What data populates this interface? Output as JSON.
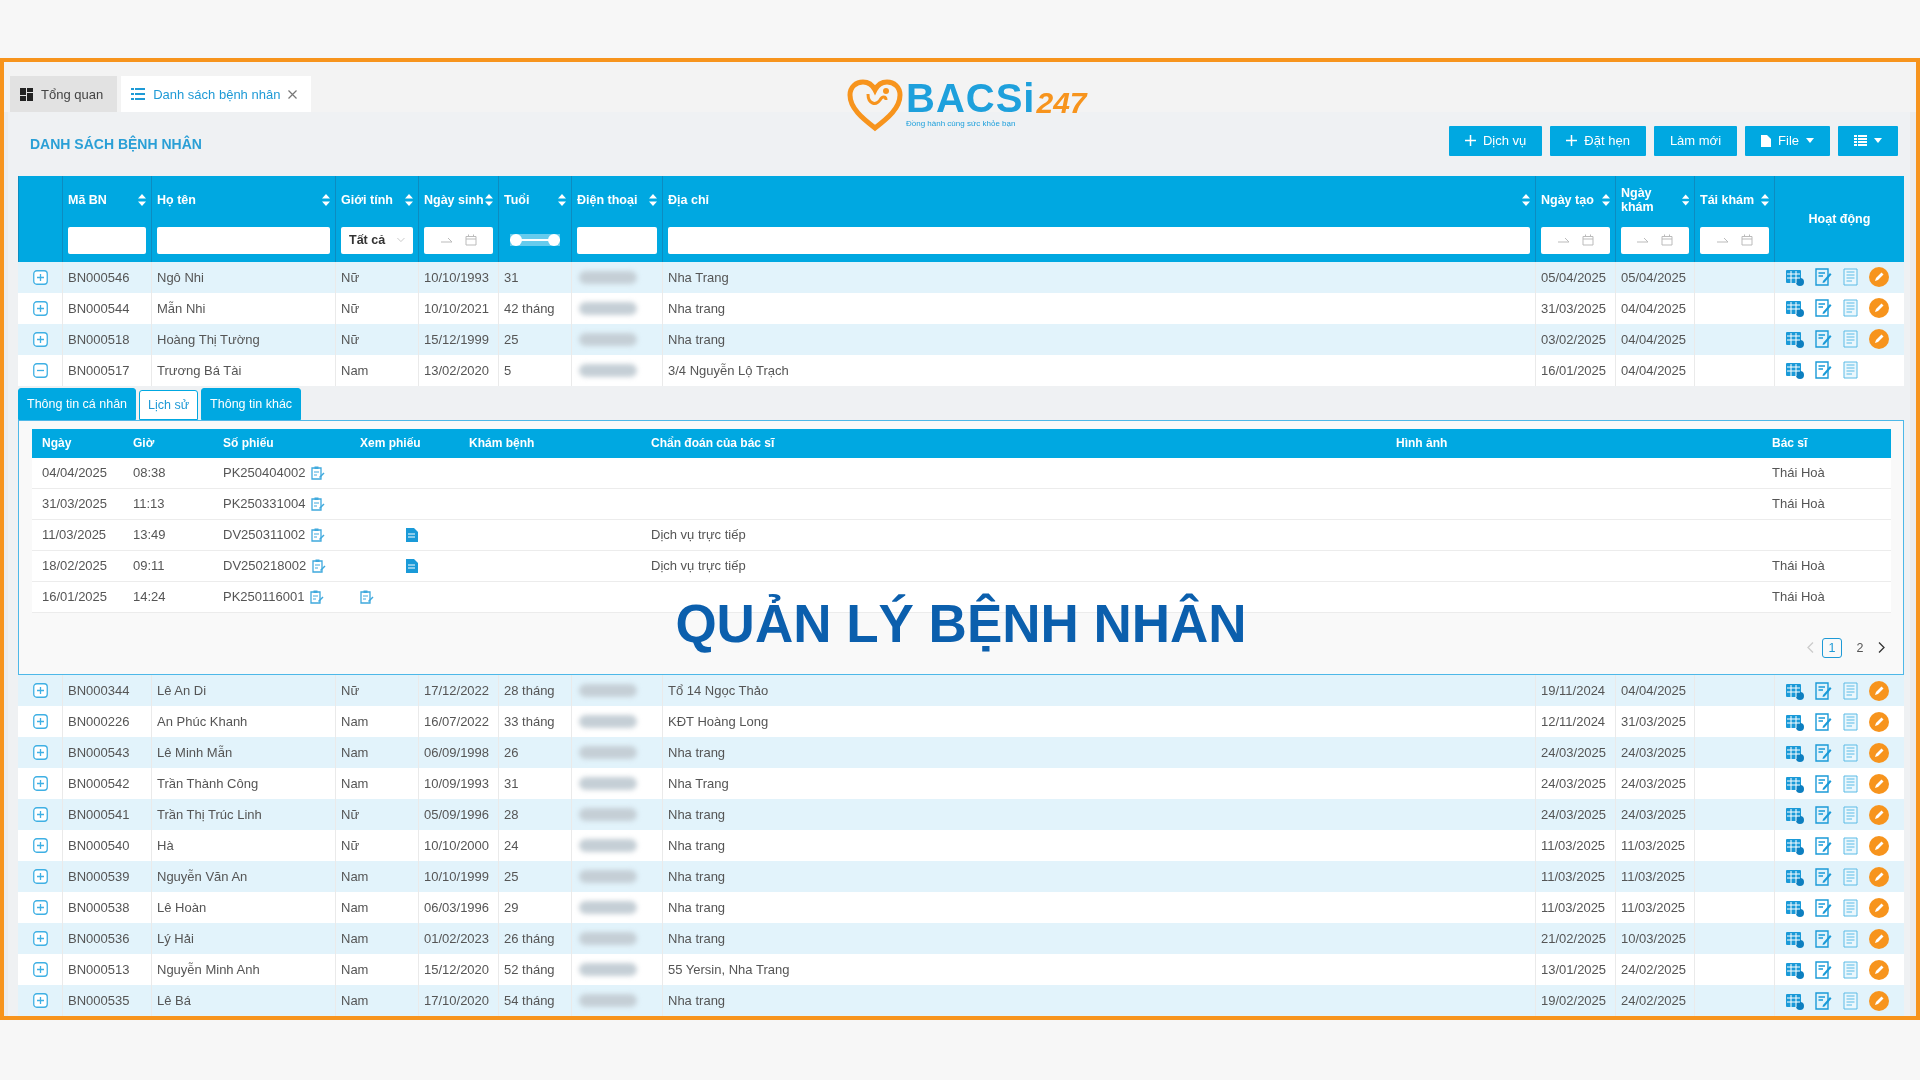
{
  "tabs": [
    {
      "label": "Tổng quan",
      "kind": "dashboard",
      "selected": false,
      "closable": false
    },
    {
      "label": "Danh sách bệnh nhân",
      "kind": "list",
      "selected": true,
      "closable": true
    }
  ],
  "logo": {
    "name": "BACSi",
    "suffix": "247",
    "tagline": "Đồng hành cùng sức khỏe bạn"
  },
  "page_title": "DANH SÁCH BỆNH NHÂN",
  "toolbar": [
    {
      "kind": "plus",
      "label": "Dịch vụ"
    },
    {
      "kind": "plus",
      "label": "Đặt hẹn"
    },
    {
      "kind": "plain",
      "label": "Làm mới"
    },
    {
      "kind": "file",
      "label": "File"
    },
    {
      "kind": "columns"
    }
  ],
  "overlay_title": "QUẢN LÝ BỆNH NHÂN",
  "table": {
    "columns": [
      {
        "label": "Mã BN",
        "sortable": true,
        "filter": {
          "kind": "text"
        }
      },
      {
        "label": "Họ tên",
        "sortable": true,
        "filter": {
          "kind": "text"
        }
      },
      {
        "label": "Giới tính",
        "sortable": true,
        "filter": {
          "kind": "select",
          "value": "Tất cả"
        }
      },
      {
        "label": "Ngày sinh",
        "sortable": true,
        "filter": {
          "kind": "date_range"
        }
      },
      {
        "label": "Tuổi",
        "sortable": true,
        "filter": {
          "kind": "range",
          "level": 1
        }
      },
      {
        "label": "Điện thoại",
        "sortable": true,
        "filter": {
          "kind": "text"
        }
      },
      {
        "label": "Địa chỉ",
        "sortable": true,
        "filter": {
          "kind": "text"
        }
      },
      {
        "label": "Ngày tạo",
        "sortable": true,
        "filter": {
          "kind": "date_range"
        }
      },
      {
        "label": "Ngày khám",
        "sortable": true,
        "filter": {
          "kind": "date_range"
        }
      },
      {
        "label": "Tái khám",
        "sortable": true,
        "filter": {
          "kind": "date_range"
        }
      },
      {
        "label": "Hoạt động",
        "sortable": false
      }
    ],
    "rows": [
      {
        "code": "BN000546",
        "name": "Ngô Nhi",
        "gender": "Nữ",
        "dob": "10/10/1993",
        "age": "31",
        "address": "Nha Trang",
        "created": "05/04/2025",
        "visit": "05/04/2025",
        "expanded": false,
        "editable": true
      },
      {
        "code": "BN000544",
        "name": "Mẫn Nhi",
        "gender": "Nữ",
        "dob": "10/10/2021",
        "age": "42 tháng",
        "address": "Nha trang",
        "created": "31/03/2025",
        "visit": "04/04/2025",
        "expanded": false,
        "editable": true
      },
      {
        "code": "BN000518",
        "name": "Hoàng Thị Tường",
        "gender": "Nữ",
        "dob": "15/12/1999",
        "age": "25",
        "address": "Nha trang",
        "created": "03/02/2025",
        "visit": "04/04/2025",
        "expanded": false,
        "editable": true
      },
      {
        "code": "BN000517",
        "name": "Trương Bá Tài",
        "gender": "Nam",
        "dob": "13/02/2020",
        "age": "5",
        "address": "3/4 Nguyễn Lộ Trạch",
        "created": "16/01/2025",
        "visit": "04/04/2025",
        "expanded": true,
        "editable": false,
        "detail": {
          "tabs": [
            {
              "label": "Thông tin cá nhân",
              "selected": false
            },
            {
              "label": "Lịch sử",
              "selected": true
            },
            {
              "label": "Thông tin khác",
              "selected": false
            }
          ],
          "columns": [
            "Ngày",
            "Giờ",
            "Số phiếu",
            "Xem phiếu",
            "Khám bệnh",
            "Chẩn đoán của bác sĩ",
            "Hình ảnh",
            "Bác sĩ"
          ],
          "rows": [
            {
              "date": "04/04/2025",
              "time": "08:38",
              "ticket": "PK250404002",
              "doctor": "Thái Hoà"
            },
            {
              "date": "31/03/2025",
              "time": "11:13",
              "ticket": "PK250331004",
              "doctor": "Thái Hoà"
            },
            {
              "date": "11/03/2025",
              "time": "13:49",
              "ticket": "DV250311002",
              "kind": "document",
              "diagnosis": "Dịch vụ trực tiếp"
            },
            {
              "date": "18/02/2025",
              "time": "09:11",
              "ticket": "DV250218002",
              "kind": "document",
              "diagnosis": "Dịch vụ trực tiếp",
              "doctor": "Thái Hoà"
            },
            {
              "date": "16/01/2025",
              "time": "14:24",
              "ticket": "PK250116001",
              "kind": "clipboard",
              "doctor": "Thái Hoà"
            }
          ],
          "pages": [
            {
              "label": "1",
              "selected": true
            },
            {
              "label": "2",
              "selected": false
            }
          ],
          "prev_disabled": true
        }
      },
      {
        "code": "BN000344",
        "name": "Lê An Di",
        "gender": "Nữ",
        "dob": "17/12/2022",
        "age": "28 tháng",
        "address": "Tổ 14 Ngọc Thảo",
        "created": "19/11/2024",
        "visit": "04/04/2025",
        "expanded": false,
        "editable": true
      },
      {
        "code": "BN000226",
        "name": "An Phúc Khanh",
        "gender": "Nam",
        "dob": "16/07/2022",
        "age": "33 tháng",
        "address": "KĐT Hoàng Long",
        "created": "12/11/2024",
        "visit": "31/03/2025",
        "expanded": false,
        "editable": true
      },
      {
        "code": "BN000543",
        "name": "Lê Minh Mẫn",
        "gender": "Nam",
        "dob": "06/09/1998",
        "age": "26",
        "address": "Nha trang",
        "created": "24/03/2025",
        "visit": "24/03/2025",
        "expanded": false,
        "editable": true
      },
      {
        "code": "BN000542",
        "name": "Trần Thành Công",
        "gender": "Nam",
        "dob": "10/09/1993",
        "age": "31",
        "address": "Nha Trang",
        "created": "24/03/2025",
        "visit": "24/03/2025",
        "expanded": false,
        "editable": true
      },
      {
        "code": "BN000541",
        "name": "Trần Thị Trúc Linh",
        "gender": "Nữ",
        "dob": "05/09/1996",
        "age": "28",
        "address": "Nha trang",
        "created": "24/03/2025",
        "visit": "24/03/2025",
        "expanded": false,
        "editable": true
      },
      {
        "code": "BN000540",
        "name": "Hà",
        "gender": "Nữ",
        "dob": "10/10/2000",
        "age": "24",
        "address": "Nha trang",
        "created": "11/03/2025",
        "visit": "11/03/2025",
        "expanded": false,
        "editable": true
      },
      {
        "code": "BN000539",
        "name": "Nguyễn Văn An",
        "gender": "Nam",
        "dob": "10/10/1999",
        "age": "25",
        "address": "Nha trang",
        "created": "11/03/2025",
        "visit": "11/03/2025",
        "expanded": false,
        "editable": true
      },
      {
        "code": "BN000538",
        "name": "Lê Hoàn",
        "gender": "Nam",
        "dob": "06/03/1996",
        "age": "29",
        "address": "Nha trang",
        "created": "11/03/2025",
        "visit": "11/03/2025",
        "expanded": false,
        "editable": true
      },
      {
        "code": "BN000536",
        "name": "Lý Hải",
        "gender": "Nam",
        "dob": "01/02/2023",
        "age": "26 tháng",
        "address": "Nha trang",
        "created": "21/02/2025",
        "visit": "10/03/2025",
        "expanded": false,
        "editable": true
      },
      {
        "code": "BN000513",
        "name": "Nguyễn Minh Anh",
        "gender": "Nam",
        "dob": "15/12/2020",
        "age": "52 tháng",
        "address": "55 Yersin, Nha Trang",
        "created": "13/01/2025",
        "visit": "24/02/2025",
        "expanded": false,
        "editable": true
      },
      {
        "code": "BN000535",
        "name": "Lê Bá",
        "gender": "Nam",
        "dob": "17/10/2020",
        "age": "54 tháng",
        "address": "Nha trang",
        "created": "19/02/2025",
        "visit": "24/02/2025",
        "expanded": false,
        "editable": true
      }
    ]
  }
}
